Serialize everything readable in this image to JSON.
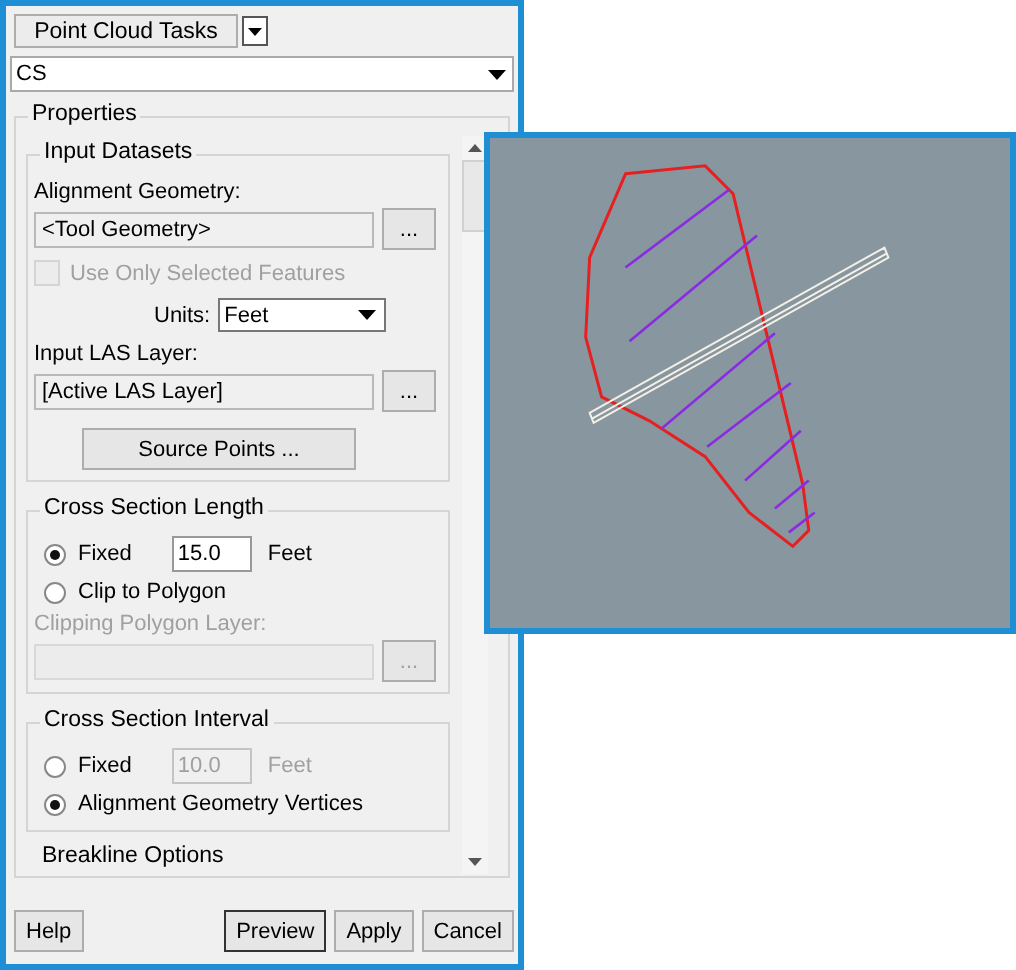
{
  "task_menu": {
    "label": "Point Cloud Tasks"
  },
  "task_combo": {
    "value": "CS"
  },
  "properties": {
    "title": "Properties",
    "groups": [
      {
        "title": "Input Datasets",
        "rows": [
          {
            "kind": "label",
            "text": "Alignment Geometry:",
            "disabled": false
          },
          {
            "kind": "picker",
            "value": "<Tool Geometry>",
            "button": "...",
            "disabled": false
          },
          {
            "kind": "checkbox",
            "label": "Use Only Selected Features",
            "checked": false,
            "disabled": true
          },
          {
            "kind": "select",
            "label": "Units:",
            "value": "Feet"
          },
          {
            "kind": "label",
            "text": "Input LAS Layer:",
            "disabled": false
          },
          {
            "kind": "picker",
            "value": "[Active LAS Layer]",
            "button": "...",
            "disabled": false
          },
          {
            "kind": "button",
            "label": "Source Points ..."
          }
        ]
      },
      {
        "title": "Cross Section Length",
        "rows": [
          {
            "kind": "radio",
            "label": "Fixed",
            "selected": true,
            "value": "15.0",
            "unit": "Feet",
            "disabled": false
          },
          {
            "kind": "radio",
            "label": "Clip to Polygon",
            "selected": false
          },
          {
            "kind": "label",
            "text": "Clipping Polygon Layer:",
            "disabled": true
          },
          {
            "kind": "picker",
            "button": "...",
            "disabled": true
          }
        ]
      },
      {
        "title": "Cross Section Interval",
        "rows": [
          {
            "kind": "radio",
            "label": "Fixed",
            "selected": false,
            "value": "10.0",
            "unit": "Feet",
            "disabled": true
          },
          {
            "kind": "radio",
            "label": "Alignment Geometry Vertices",
            "selected": true
          }
        ]
      },
      {
        "title": "Breakline Options"
      }
    ]
  },
  "buttons": [
    {
      "label": "Help",
      "default": false
    },
    {
      "label": "Preview",
      "default": true
    },
    {
      "label": "Apply",
      "default": false
    },
    {
      "label": "Cancel",
      "default": false
    }
  ]
}
